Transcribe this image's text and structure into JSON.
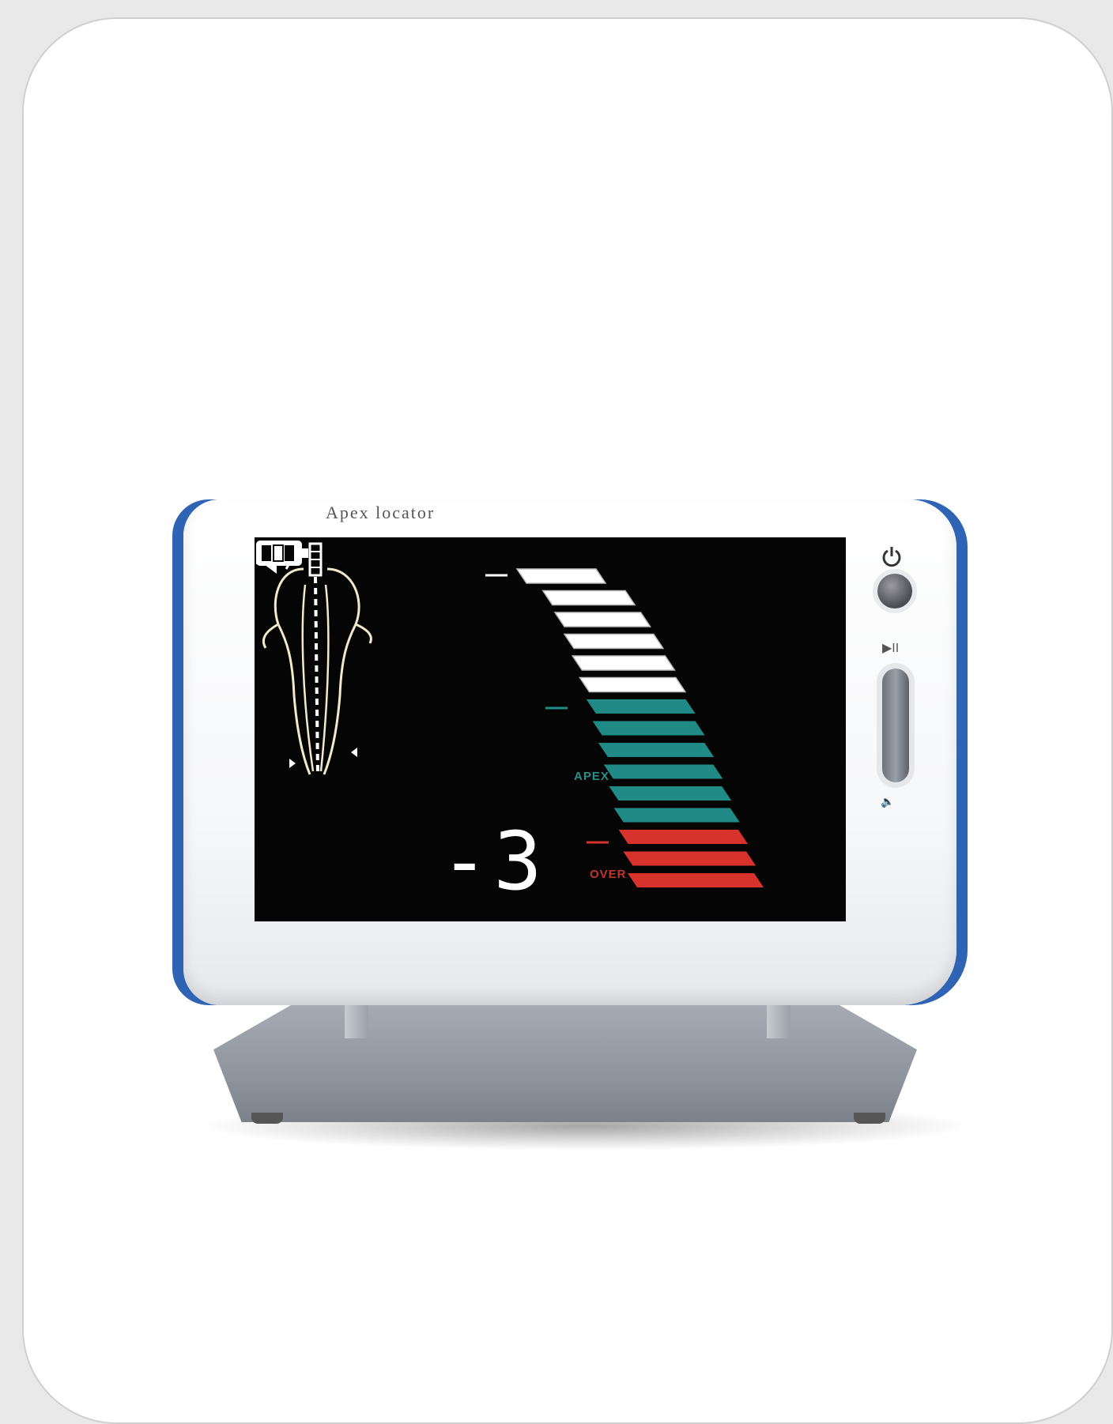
{
  "device": {
    "brand": "Apex locator",
    "display": {
      "reading": "-3",
      "apex_label": "APEX",
      "over_label": "OVER",
      "bars": {
        "white_count": 6,
        "teal_count": 6,
        "red_count": 3
      }
    },
    "controls": {
      "power_symbol": "⏻",
      "play_pause_symbol": "▶II",
      "volume_symbol": "🔈"
    }
  },
  "colors": {
    "accent_blue": "#2f63b3",
    "bar_white": "#ffffff",
    "bar_teal": "#1f8a86",
    "bar_red": "#d8322c"
  }
}
